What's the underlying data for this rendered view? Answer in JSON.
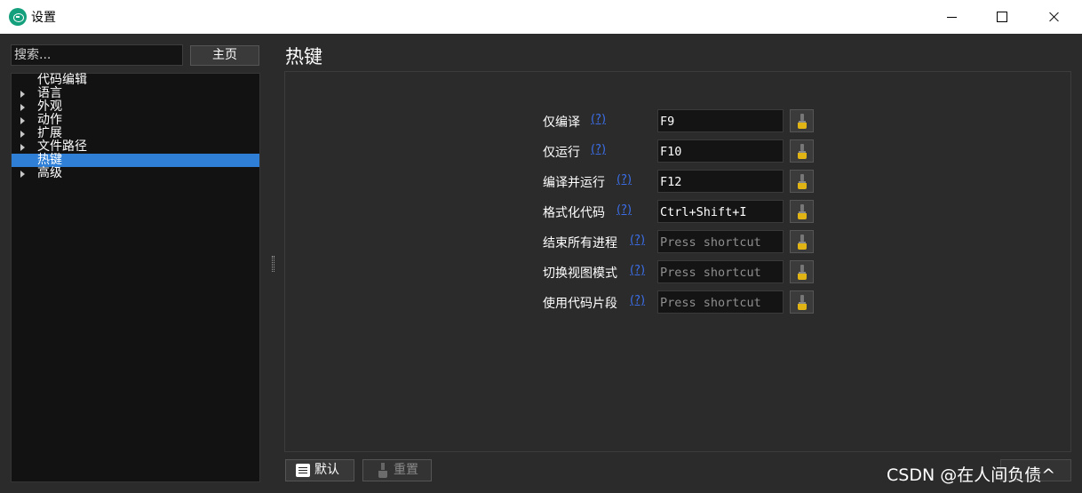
{
  "window": {
    "title": "设置"
  },
  "sidebar": {
    "search_placeholder": "搜索...",
    "home_label": "主页",
    "items": [
      {
        "label": "代码编辑",
        "expandable": false,
        "selected": false
      },
      {
        "label": "语言",
        "expandable": true,
        "selected": false
      },
      {
        "label": "外观",
        "expandable": true,
        "selected": false
      },
      {
        "label": "动作",
        "expandable": true,
        "selected": false
      },
      {
        "label": "扩展",
        "expandable": true,
        "selected": false
      },
      {
        "label": "文件路径",
        "expandable": true,
        "selected": false
      },
      {
        "label": "热键",
        "expandable": false,
        "selected": true
      },
      {
        "label": "高级",
        "expandable": true,
        "selected": false
      }
    ]
  },
  "main": {
    "title": "热键",
    "help_text": "(?)",
    "hotkeys": [
      {
        "label": "仅编译",
        "value": "F9",
        "placeholder": ""
      },
      {
        "label": "仅运行",
        "value": "F10",
        "placeholder": ""
      },
      {
        "label": "编译并运行",
        "value": "F12",
        "placeholder": ""
      },
      {
        "label": "格式化代码",
        "value": "Ctrl+Shift+I",
        "placeholder": ""
      },
      {
        "label": "结束所有进程",
        "value": "",
        "placeholder": "Press shortcut"
      },
      {
        "label": "切换视图模式",
        "value": "",
        "placeholder": "Press shortcut"
      },
      {
        "label": "使用代码片段",
        "value": "",
        "placeholder": "Press shortcut"
      }
    ]
  },
  "footer": {
    "default_label": "默认",
    "reset_label": "重置"
  },
  "watermark": "CSDN @在人间负债^",
  "colors": {
    "selection": "#2f7fd6",
    "help_link": "#3b6ee8",
    "brush": "#e0b415",
    "app_icon": "#14a07c"
  },
  "icons": {
    "app": "app-logo-icon",
    "clear": "brush-icon",
    "default": "document-icon",
    "reset": "brush-icon",
    "expand": "triangle-right-icon"
  }
}
